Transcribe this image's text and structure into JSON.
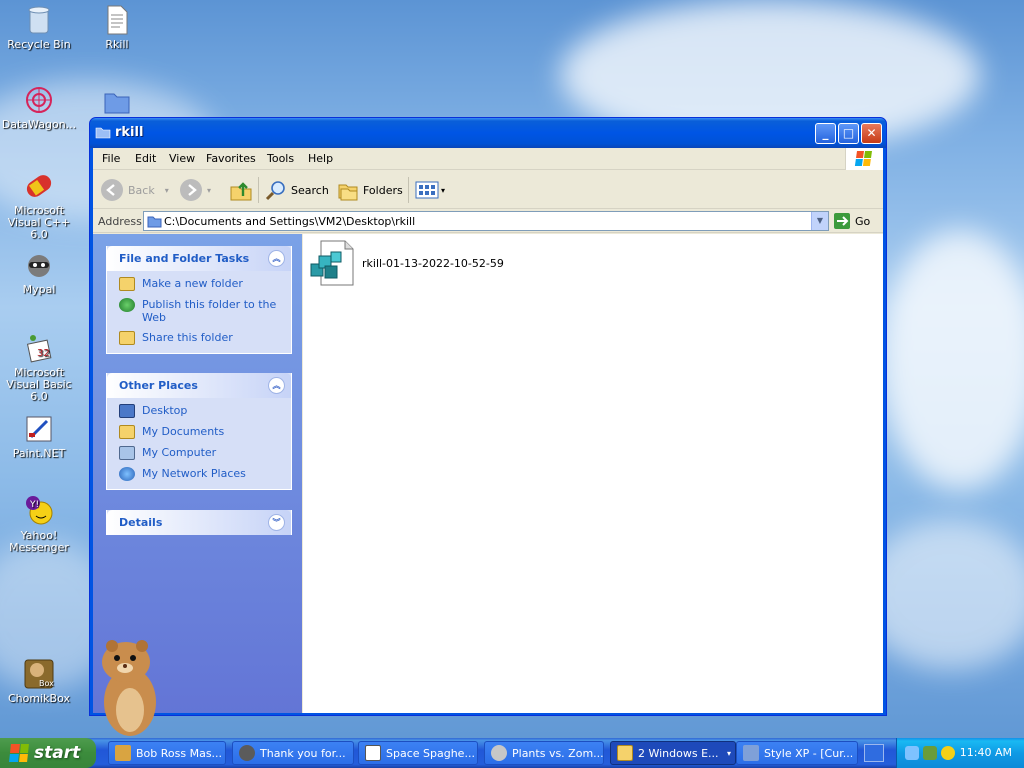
{
  "desktop": {
    "icons": [
      {
        "label": "Recycle Bin"
      },
      {
        "label": "Rkill"
      },
      {
        "label": "DataWagon..."
      },
      {
        "label": "Microsoft Visual C++ 6.0"
      },
      {
        "label": "Mypal"
      },
      {
        "label": "Microsoft Visual Basic 6.0"
      },
      {
        "label": "Paint.NET"
      },
      {
        "label": "Yahoo! Messenger"
      },
      {
        "label": "ChomikBox"
      }
    ]
  },
  "window": {
    "title": "rkill",
    "menu": [
      "File",
      "Edit",
      "View",
      "Favorites",
      "Tools",
      "Help"
    ],
    "toolbar": {
      "back": "Back",
      "search": "Search",
      "folders": "Folders"
    },
    "address": {
      "label": "Address",
      "path": "C:\\Documents and Settings\\VM2\\Desktop\\rkill",
      "go": "Go"
    },
    "tasks_panel": {
      "title": "File and Folder Tasks",
      "items": [
        "Make a new folder",
        "Publish this folder to the Web",
        "Share this folder"
      ]
    },
    "places_panel": {
      "title": "Other Places",
      "items": [
        "Desktop",
        "My Documents",
        "My Computer",
        "My Network Places"
      ]
    },
    "details_panel": {
      "title": "Details"
    },
    "files": [
      {
        "name": "rkill-01-13-2022-10-52-59"
      }
    ]
  },
  "taskbar": {
    "start_label": "start",
    "tasks": [
      {
        "label": "Bob Ross Mas..."
      },
      {
        "label": "Thank you for..."
      },
      {
        "label": "Space Spaghe..."
      },
      {
        "label": "Plants vs. Zom..."
      },
      {
        "label": "2 Windows E..."
      },
      {
        "label": "Style XP - [Cur..."
      }
    ],
    "clock": "11:40 AM"
  },
  "colors": {
    "accent": "#0054e3",
    "link": "#215dc6",
    "start_green": "#3c8c3c"
  }
}
